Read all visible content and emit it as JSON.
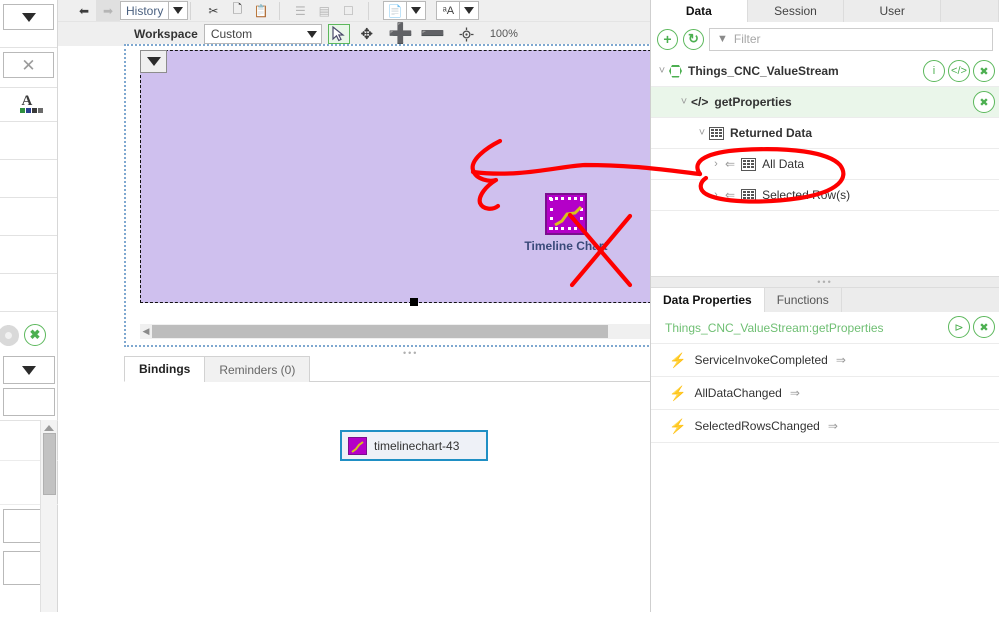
{
  "toolbar": {
    "undo_icon": "undo-arrow-icon",
    "redo_icon": "redo-arrow-icon",
    "history_label": "History",
    "cut_icon": "scissors-icon",
    "copy_icon": "copy-icon",
    "paste_icon": "paste-icon",
    "align_icon": "align-icon",
    "distribute_icon": "distribute-icon",
    "fit_icon": "fit-icon",
    "layers_icon": "layers-icon",
    "text_icon": "text-style-icon"
  },
  "workspace": {
    "label": "Workspace",
    "selected": "Custom",
    "tool_select_icon": "cursor-arrow-icon",
    "tool_pan_icon": "move-icon",
    "tool_zoom_in_icon": "plus-icon",
    "tool_zoom_out_icon": "minus-icon",
    "tool_center_icon": "target-icon",
    "zoom_level": "100%"
  },
  "canvas": {
    "widget_label": "Timeline Chart",
    "widget_icon": "timeline-chart-icon",
    "dropdown_icon": "caret-down-icon",
    "background_color": "#cfc0ee"
  },
  "bindings": {
    "tabs": [
      {
        "label": "Bindings",
        "active": true
      },
      {
        "label": "Reminders (0)",
        "active": false
      }
    ],
    "chip_label": "timelinechart-43",
    "chip_icon": "timeline-chart-icon",
    "chip_border_color": "#1f8fc4"
  },
  "left_strip": {
    "dropdown_icon": "caret-down-icon",
    "close_icon": "close-x-icon",
    "font_icon": "font-color-icon",
    "gear_icon": "gear-icon",
    "remove_icon": "green-close-icon",
    "scroll_up_icon": "scroll-up-arrow-icon"
  },
  "right_panel": {
    "tabs": [
      {
        "label": "Data",
        "active": true
      },
      {
        "label": "Session",
        "active": false
      },
      {
        "label": "User",
        "active": false
      }
    ],
    "add_icon": "plus-circle-icon",
    "refresh_icon": "refresh-circle-icon",
    "filter_icon": "funnel-icon",
    "filter_placeholder": "Filter",
    "tree": [
      {
        "label": "Things_CNC_ValueStream",
        "icon": "hexagon-icon",
        "chevron": "chevron-down-icon",
        "indent": 0,
        "bold": true,
        "shaded": false,
        "actions": [
          "info-icon",
          "code-icon",
          "close-icon"
        ]
      },
      {
        "label": "getProperties",
        "icon": "code-icon",
        "chevron": "chevron-down-icon",
        "indent": 1,
        "bold": true,
        "shaded": true,
        "actions": [
          "close-icon"
        ]
      },
      {
        "label": "Returned Data",
        "icon": "table-icon",
        "chevron": "chevron-down-icon",
        "indent": 2,
        "bold": true,
        "shaded": false,
        "actions": []
      },
      {
        "label": "All Data",
        "icon": "table-icon",
        "chevron": "chevron-right-icon",
        "indent": 3,
        "bold": false,
        "shaded": false,
        "bind_arrow": "bind-arrow-icon",
        "actions": []
      },
      {
        "label": "Selected Row(s)",
        "icon": "table-icon",
        "chevron": "chevron-right-icon",
        "indent": 3,
        "bold": false,
        "shaded": false,
        "bind_arrow": "bind-arrow-icon",
        "actions": []
      }
    ],
    "properties": {
      "tabs": [
        {
          "label": "Data Properties",
          "active": true
        },
        {
          "label": "Functions",
          "active": false
        }
      ],
      "title": "Things_CNC_ValueStream:getProperties",
      "title_color": "#6fbf73",
      "share_icon": "share-icon",
      "close_icon": "close-icon",
      "events": [
        {
          "label": "ServiceInvokeCompleted",
          "icon": "bolt-icon",
          "arrow": "implement-arrow-icon"
        },
        {
          "label": "AllDataChanged",
          "icon": "bolt-icon",
          "arrow": "implement-arrow-icon"
        },
        {
          "label": "SelectedRowsChanged",
          "icon": "bolt-icon",
          "arrow": "implement-arrow-icon"
        }
      ]
    }
  },
  "annotations": {
    "ink_color": "#fe0000",
    "marks": [
      "arrow-pointing-to-all-data",
      "circle-around-all-data",
      "red-x-mark"
    ]
  }
}
